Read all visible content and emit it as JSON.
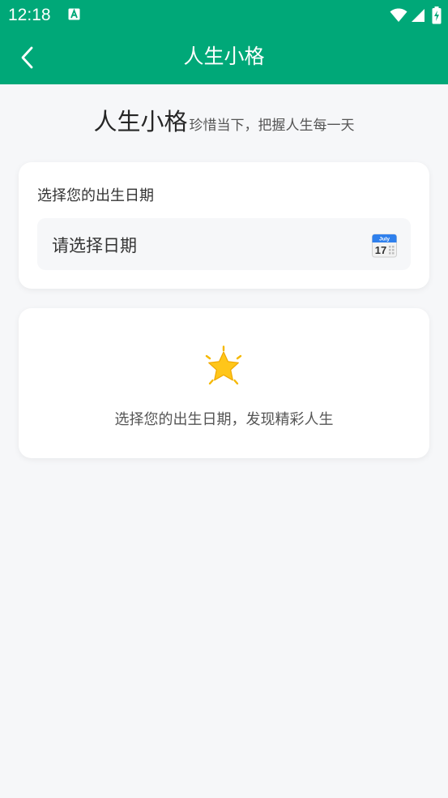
{
  "status_bar": {
    "time": "12:18",
    "icons": [
      "keyboard-a-icon",
      "wifi-icon",
      "signal-icon",
      "battery-charging-icon"
    ]
  },
  "app_bar": {
    "title": "人生小格",
    "back_icon": "chevron-left-icon"
  },
  "hero": {
    "title": "人生小格",
    "subtitle": "珍惜当下，把握人生每一天"
  },
  "date_card": {
    "label": "选择您的出生日期",
    "placeholder": "请选择日期",
    "calendar_icon": "calendar-icon",
    "calendar_month": "July",
    "calendar_day": "17"
  },
  "empty_state": {
    "icon": "star-icon",
    "text": "选择您的出生日期，发现精彩人生"
  },
  "colors": {
    "primary": "#00a878",
    "background": "#f6f7f9",
    "card": "#ffffff",
    "text": "#333333",
    "muted": "#555555"
  }
}
